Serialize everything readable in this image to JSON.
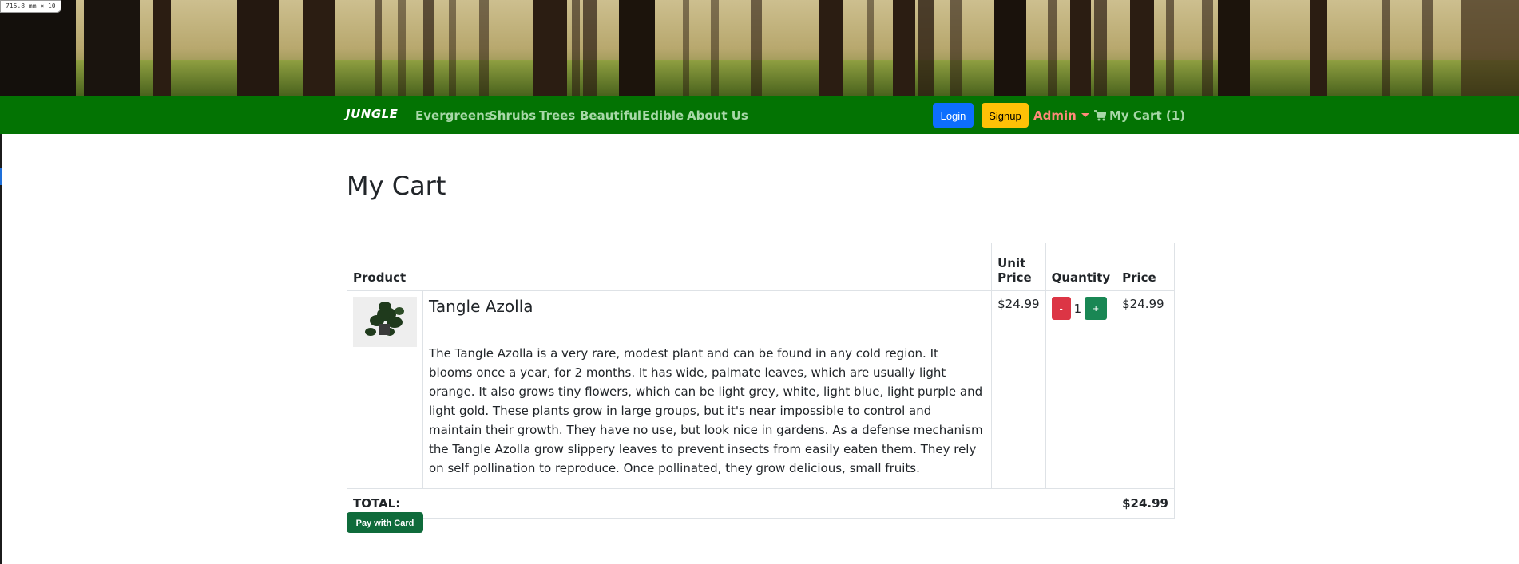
{
  "measure_badge": "715.8 mm × 10",
  "nav": {
    "brand": "JUNGLE",
    "links": [
      "Evergreens",
      "Shrubs",
      "Trees",
      "Beautiful",
      "Edible",
      "About Us"
    ],
    "login_label": "Login",
    "signup_label": "Signup",
    "admin_label": "Admin",
    "cart_label": "My Cart (1)"
  },
  "page": {
    "title": "My Cart"
  },
  "table": {
    "headers": {
      "product": "Product",
      "unit_price": "Unit Price",
      "quantity": "Quantity",
      "price": "Price"
    },
    "items": [
      {
        "name": "Tangle Azolla",
        "description": "The Tangle Azolla is a very rare, modest plant and can be found in any cold region. It blooms once a year, for 2 months. It has wide, palmate leaves, which are usually light orange. It also grows tiny flowers, which can be light grey, white, light blue, light purple and light gold. These plants grow in large groups, but it's near impossible to control and maintain their growth. They have no use, but look nice in gardens. As a defense mechanism the Tangle Azolla grow slippery leaves to prevent insects from easily eaten them. They rely on self pollination to reproduce. Once pollinated, they grow delicious, small fruits.",
        "unit_price": "$24.99",
        "quantity": "1",
        "decrement_label": "-",
        "increment_label": "+",
        "price": "$24.99"
      }
    ],
    "total_label": "TOTAL:",
    "total_value": "$24.99"
  },
  "pay_button_label": "Pay with Card",
  "colors": {
    "navbar": "#037303",
    "nav_link": "#a8d8a8",
    "admin": "#ff8a7a",
    "login": "#0d6efd",
    "signup": "#ffc107",
    "minus": "#dc3545",
    "plus": "#198754",
    "pay": "#0f6b3b"
  },
  "icons": {
    "cart": "cart-icon",
    "admin_caret": "caret-down-icon",
    "thumb": "plant-photo"
  }
}
